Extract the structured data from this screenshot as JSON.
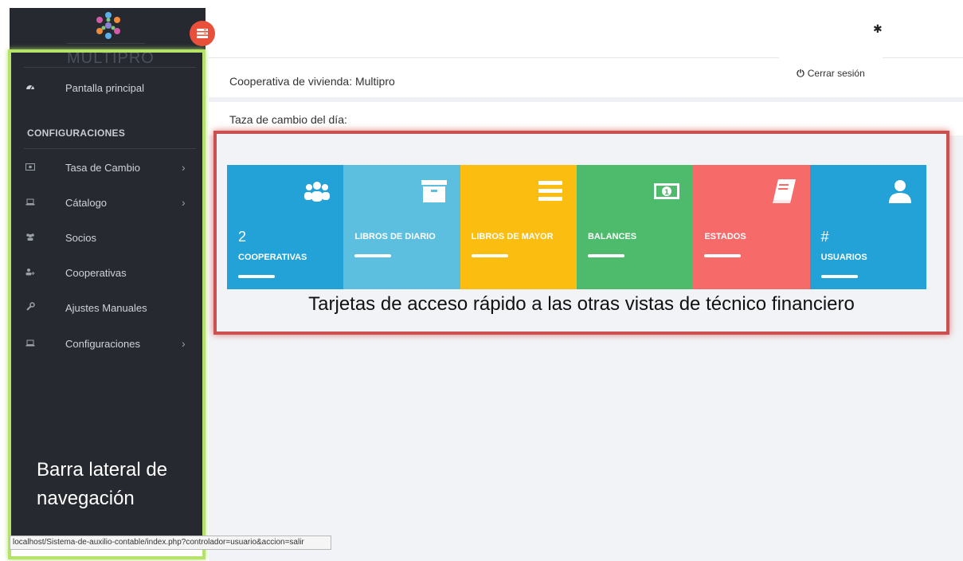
{
  "brand": {
    "name": "MULTIPRO"
  },
  "sidebar": {
    "items_top": [
      {
        "label": "Pantalla principal",
        "icon": "dashboard-icon"
      }
    ],
    "section_title": "CONFIGURACIONES",
    "items": [
      {
        "label": "Tasa de Cambio",
        "icon": "money-icon",
        "has_submenu": true
      },
      {
        "label": "Cátalogo",
        "icon": "laptop-icon",
        "has_submenu": true
      },
      {
        "label": "Socios",
        "icon": "users-icon",
        "has_submenu": false
      },
      {
        "label": "Cooperativas",
        "icon": "user-plus-icon",
        "has_submenu": false
      },
      {
        "label": "Ajustes Manuales",
        "icon": "wrench-icon",
        "has_submenu": false
      },
      {
        "label": "Configuraciones",
        "icon": "laptop-icon",
        "has_submenu": true
      }
    ],
    "chevron": "›",
    "annotation_line1": "Barra lateral de",
    "annotation_line2": "navegación"
  },
  "header": {
    "logout_label": "Cerrar sesión",
    "logout_icon": "⏻",
    "gear_icon": "✱"
  },
  "main": {
    "breadcrumb": "Cooperativa de vivienda: Multipro",
    "exchange_label": "Taza de cambio del día:",
    "cards": [
      {
        "number": "2",
        "label": "COOPERATIVAS",
        "color": "#22a2d6",
        "icon": "users-icon"
      },
      {
        "number": "",
        "label": "LIBROS DE DIARIO",
        "color": "#5dbfdf",
        "icon": "archive-icon"
      },
      {
        "number": "",
        "label": "LIBROS DE MAYOR",
        "color": "#fbbe10",
        "icon": "bars-icon"
      },
      {
        "number": "",
        "label": "BALANCES",
        "color": "#4dba6c",
        "icon": "money-icon"
      },
      {
        "number": "",
        "label": "ESTADOS",
        "color": "#f76a6a",
        "icon": "book-icon"
      },
      {
        "number": "#",
        "label": "USUARIOS",
        "color": "#22a2d6",
        "icon": "user-icon"
      }
    ],
    "annotation": "Tarjetas de acceso rápido a las otras vistas de técnico financiero"
  },
  "statusbar": {
    "url": "localhost/Sistema-de-auxilio-contable/index.php?controlador=usuario&accion=salir"
  },
  "colors": {
    "sidebar_bg": "#262a30",
    "toggle": "#e8503a",
    "highlight_green": "#b5e36a",
    "highlight_red": "#c9514f"
  }
}
